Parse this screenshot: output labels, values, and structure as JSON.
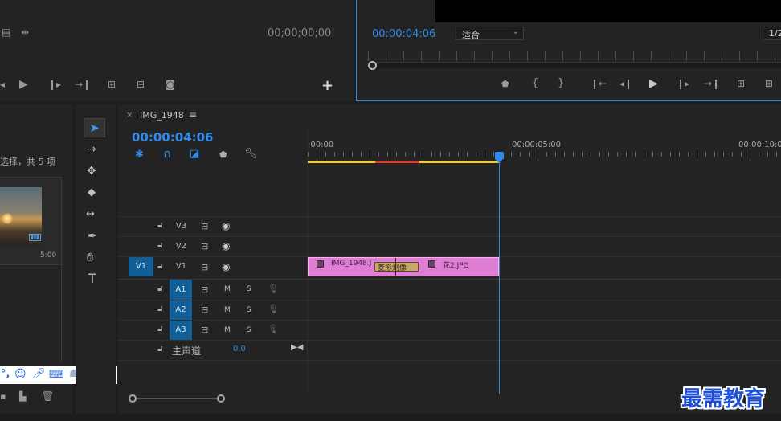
{
  "source_monitor": {
    "timecode": "00;00;00;00"
  },
  "program_monitor": {
    "timecode": "00:00:04:06",
    "fit_select": "适合",
    "resolution": "1/2"
  },
  "project_panel": {
    "selection_text": "选择，共 5 项",
    "thumb_duration": "5:00"
  },
  "timeline": {
    "sequence_name": "IMG_1948",
    "timecode": "00:00:04:06",
    "ruler_labels": [
      ":00:00",
      "00:00:05:00",
      "00:00:10:0"
    ],
    "video_tracks": [
      {
        "name": "V3",
        "source": ""
      },
      {
        "name": "V2",
        "source": ""
      },
      {
        "name": "V1",
        "source": "V1"
      }
    ],
    "audio_tracks": [
      {
        "name": "A1",
        "m": "M",
        "s": "S"
      },
      {
        "name": "A2",
        "m": "M",
        "s": "S"
      },
      {
        "name": "A3",
        "m": "M",
        "s": "S"
      }
    ],
    "master": {
      "label": "主声道",
      "value": "0.0"
    },
    "clips": [
      {
        "name": "IMG_1948.J"
      },
      {
        "name": "花2.JPG"
      }
    ],
    "transition_label": "菱形划像"
  },
  "watermark": "最需教育",
  "colors": {
    "accent_blue": "#2d8ceb",
    "clip_pink": "#e07ed6",
    "track_blue": "#125e96",
    "transition_tan": "#c7a86a"
  }
}
